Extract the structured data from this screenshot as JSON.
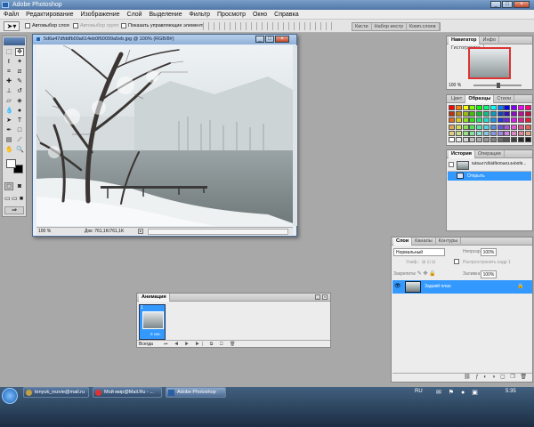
{
  "app": {
    "title": "Adobe Photoshop"
  },
  "menu": [
    "Файл",
    "Редактирование",
    "Изображение",
    "Слой",
    "Выделение",
    "Фильтр",
    "Просмотр",
    "Окно",
    "Справка"
  ],
  "options": {
    "autoselect_layer": "Автовыбор слоя",
    "autoselect_group": "Автовыбор групп",
    "show_controls": "Показать управляющие элементы",
    "palette_tabs": [
      "Кисти",
      "Набор инстр",
      "Комп.слоев"
    ]
  },
  "document": {
    "title": "5d6a47dfddfb00a614eb0f60099a5eb.jpg @ 100% (RGB/8#)",
    "zoom": "100 %",
    "status": "Док: 761,1K/761,1K"
  },
  "navigator": {
    "tabs": [
      "Навигатор",
      "Инфо",
      "Гистограмма"
    ],
    "zoom": "100 %"
  },
  "colors": {
    "tabs": [
      "Цвет",
      "Образцы",
      "Стили"
    ]
  },
  "history": {
    "tabs": [
      "История",
      "Операции"
    ],
    "snapshot": "5d6a47dfddfb00a614eb0f6...",
    "state": "Открыть"
  },
  "layers": {
    "tabs": [
      "Слои",
      "Каналы",
      "Контуры"
    ],
    "blend_mode": "Нормальный",
    "opacity_label": "Непрозр.:",
    "opacity": "100%",
    "unify_label": "Униф.:",
    "propagate": "Распространить кадр 1",
    "lock_label": "Закрепить:",
    "fill_label": "Заливка:",
    "fill": "100%",
    "layer_name": "Задний план"
  },
  "animation": {
    "title": "Анимация",
    "frame_num": "1",
    "frame_time": "0 сек.",
    "loop": "Всегда"
  },
  "taskbar": {
    "tasks": [
      "tenyuk_rezvie@mail.ru",
      "Мой мир@Mail.Ru - ...",
      "Adobe Photoshop"
    ],
    "lang": "RU",
    "time": "5:35"
  },
  "accent": {
    "selection": "#3399ff",
    "title": "#4f77a7"
  }
}
